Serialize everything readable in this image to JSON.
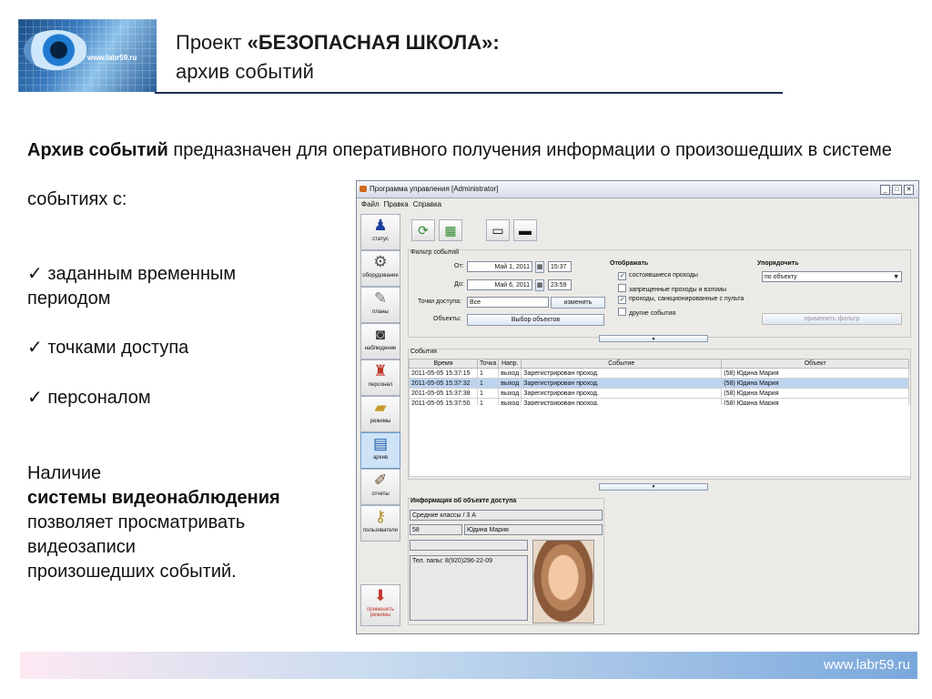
{
  "header": {
    "title_prefix": "Проект ",
    "title_bold": "«БЕЗОПАСНАЯ ШКОЛА»:",
    "subtitle": "архив событий",
    "logo_url": "www.labr59.ru"
  },
  "body": {
    "intro_bold": "Архив событий",
    "intro_rest": " предназначен для оперативного получения информации о произошедших в системе",
    "intro_line2": "событиях с:",
    "bullet_1_a": "✓ заданным временным",
    "bullet_1_b": "периодом",
    "bullet_2": "✓ точками доступа",
    "bullet_3": "✓ персоналом",
    "video_1": "Наличие",
    "video_2": "системы видеонаблюдения",
    "video_3": "позволяет просматривать",
    "video_4": "видеозаписи",
    "video_5": "произошедших событий."
  },
  "window": {
    "title": "Программа управления [Administrator]",
    "menu": [
      "Файл",
      "Правка",
      "Справка"
    ],
    "sidebar": [
      "статус",
      "оборудование",
      "планы",
      "наблюдение",
      "персонал",
      "режимы",
      "архив",
      "отчеты",
      "пользователи"
    ],
    "sidebar_bottom": "применить режимы",
    "filter": {
      "title": "Фильтр событий",
      "from_label": "От:",
      "from_date": "Май 1, 2011",
      "from_time": "15:37",
      "to_label": "До:",
      "to_date": "Май 6, 2011",
      "to_time": "23:59",
      "points_label": "Точки доступа:",
      "points_value": "Все",
      "change_btn": "изменить",
      "objects_label": "Объекты:",
      "objects_btn": "Выбор объектов",
      "display_label": "Отображать",
      "cb1": "состоявшиеся проходы",
      "cb2": "запрещенные проходы и взломы",
      "cb3": "проходы, санкционированные с пульта",
      "cb4": "другие события",
      "sort_label": "Упорядочить",
      "sort_value": "по объекту",
      "apply_btn": "применить фильтр"
    },
    "events": {
      "title": "События",
      "columns": [
        "Время",
        "Точка",
        "Напр.",
        "Событие",
        "Объект"
      ],
      "rows": [
        [
          "2011-05-05 15:37:15",
          "1",
          "выход",
          "Зарегистрирован проход.",
          "(58) Юдина Мария"
        ],
        [
          "2011-05-05 15:37:32",
          "1",
          "выход",
          "Зарегистрирован проход.",
          "(58) Юдина Мария"
        ],
        [
          "2011-05-05 15:37:38",
          "1",
          "выход",
          "Зарегистрирован проход.",
          "(58) Юдина Мария"
        ],
        [
          "2011-05-05 15:37:50",
          "1",
          "выход",
          "Зарегистрирован проход.",
          "(58) Юдина Мария"
        ]
      ]
    },
    "info": {
      "title": "Информация об объекте доступа",
      "class": "Средние классы / 3 А",
      "id": "58",
      "name": "Юдина Мария",
      "blank": "",
      "phone": "Тел. папы: 8(920)296-22-09"
    }
  },
  "footer": {
    "url": "www.labr59.ru"
  }
}
